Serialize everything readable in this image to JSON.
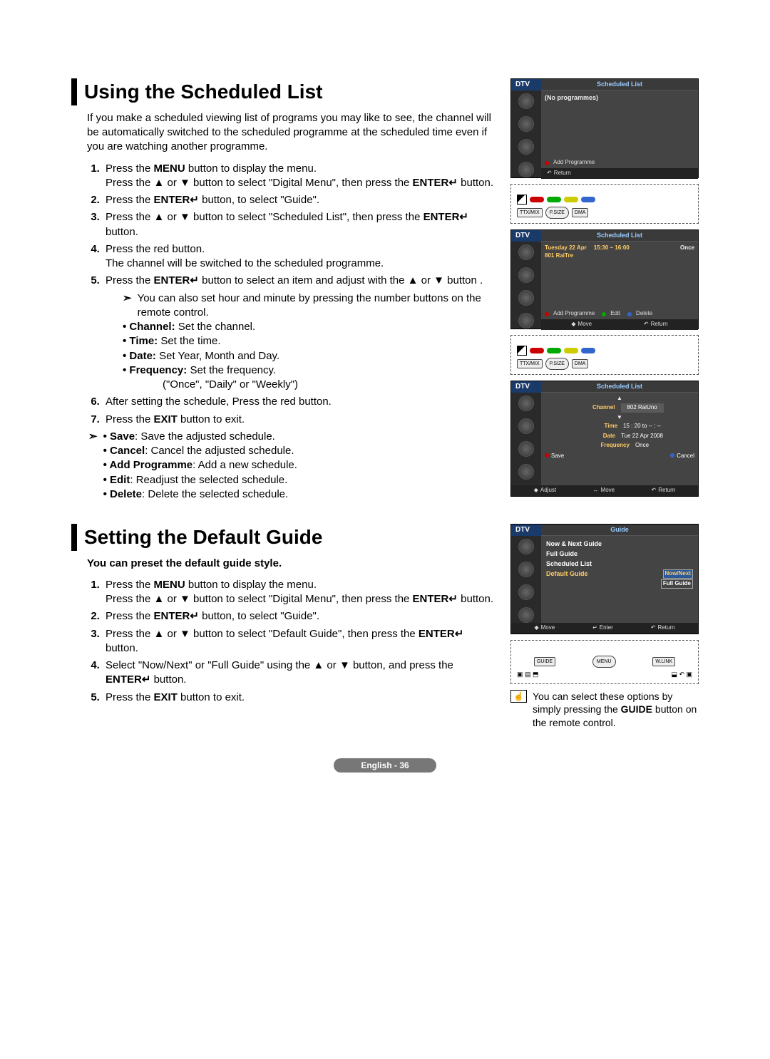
{
  "section1": {
    "heading": "Using the Scheduled List",
    "intro": "If you make a scheduled viewing list of programs you may like to see, the channel will be automatically switched to the scheduled programme at the scheduled time even if you are watching another programme.",
    "steps": {
      "s1a": "Press the ",
      "s1b": "MENU",
      "s1c": " button to display the menu.",
      "s1d": "Press the ▲ or ▼ button to select \"Digital Menu\", then press the ",
      "s1e": "ENTER",
      "s1f": " button.",
      "s2a": "Press the ",
      "s2b": "ENTER",
      "s2c": " button, to select \"Guide\".",
      "s3a": "Press the ▲ or ▼ button to select \"Scheduled List\", then press the ",
      "s3b": "ENTER",
      "s3c": " button.",
      "s4a": "Press the red button.",
      "s4b": "The channel will be switched to the scheduled programme.",
      "s5a": "Press the ",
      "s5b": "ENTER",
      "s5c": " button to select an item and adjust with the ▲ or ▼ button .",
      "s5note": "You can also set hour and minute by pressing the number buttons on the remote control.",
      "s5_channel_l": "Channel:",
      "s5_channel_t": " Set the channel.",
      "s5_time_l": "Time:",
      "s5_time_t": " Set the time.",
      "s5_date_l": "Date:",
      "s5_date_t": " Set Year, Month and Day.",
      "s5_freq_l": "Frequency:",
      "s5_freq_t": " Set the frequency.",
      "s5_freq_vals": "(\"Once\", \"Daily\" or \"Weekly\")",
      "s6": "After setting the schedule, Press the red button.",
      "s7a": "Press the ",
      "s7b": "EXIT",
      "s7c": " button to exit.",
      "save_l": "Save",
      "save_t": ": Save the adjusted schedule.",
      "cancel_l": "Cancel",
      "cancel_t": ": Cancel the adjusted schedule.",
      "add_l": "Add Programme",
      "add_t": ": Add a new schedule.",
      "edit_l": "Edit",
      "edit_t": ": Readjust the selected schedule.",
      "delete_l": "Delete",
      "delete_t": ": Delete the selected schedule."
    }
  },
  "section2": {
    "heading": "Setting the Default Guide",
    "intro": "You can preset the default guide style.",
    "steps": {
      "s1a": "Press the ",
      "s1b": "MENU",
      "s1c": " button to display the menu.",
      "s1d": "Press the ▲ or ▼ button to select \"Digital Menu\", then press the ",
      "s1e": "ENTER",
      "s1f": " button.",
      "s2a": "Press the ",
      "s2b": "ENTER",
      "s2c": " button, to select \"Guide\".",
      "s3a": "Press the ▲ or ▼ button to select \"Default Guide\", then press the ",
      "s3b": "ENTER",
      "s3c": " button.",
      "s4a": "Select \"Now/Next\" or \"Full Guide\" using the ▲ or ▼ button, and press the ",
      "s4b": "ENTER",
      "s4c": " button.",
      "s5a": "Press the ",
      "s5b": "EXIT",
      "s5c": " button to exit."
    },
    "tip": "You can select these options by simply pressing the ",
    "tip_b": "GUIDE",
    "tip_end": " button on the remote control."
  },
  "osd": {
    "dtv": "DTV",
    "sched_title": "Scheduled List",
    "noprog": "(No programmes)",
    "add_prog": "Add Programme",
    "return": "Return",
    "row_date": "Tuesday  22  Apr",
    "row_time": "15:30 ~ 16:00",
    "row_once": "Once",
    "row_ch": "801  RaiTre",
    "edit": "Edit",
    "delete": "Delete",
    "move": "Move",
    "form_channel_l": "Channel",
    "form_channel_v": "802 RaiUno",
    "form_time_l": "Time",
    "form_time_v": "15 : 20 to -- : --",
    "form_date_l": "Date",
    "form_date_v": "Tue 22 Apr 2008",
    "form_freq_l": "Frequency",
    "form_freq_v": "Once",
    "save": "Save",
    "cancel": "Cancel",
    "adjust": "Adjust",
    "guide_title": "Guide",
    "g_now": "Now & Next Guide",
    "g_full": "Full Guide",
    "g_sched": "Scheduled List",
    "g_default": "Default Guide",
    "g_opt_now": "Now/Next",
    "g_opt_full": "Full Guide",
    "enter": "Enter"
  },
  "remote": {
    "ttx": "TTX/MIX",
    "size": "P.SIZE",
    "dma": "DMA",
    "guide": "GUIDE",
    "menu": "MENU",
    "wlink": "W.LINK"
  },
  "footer": "English - 36"
}
